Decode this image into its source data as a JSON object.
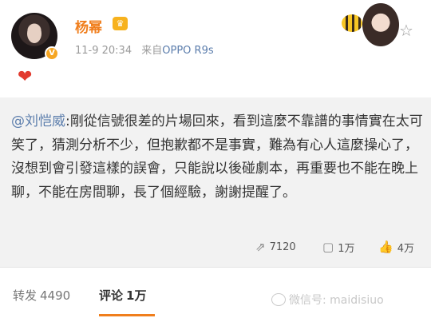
{
  "user": {
    "name": "杨幂",
    "verified_badge": "V",
    "member_badge": "♛",
    "time": "11-9 20:34",
    "source_prefix": "来自",
    "source": "OPPO R9s"
  },
  "post": {
    "emoji": "heart-icon"
  },
  "repost": {
    "mention": "@刘恺威",
    "text": ":剛從信號很差的片場回來，看到這麼不靠譜的事情實在太可笑了，猜測分析不少，但抱歉都不是事實，難為有心人這麼操心了，沒想到會引發這樣的誤會，只能說以後碰劇本，再重要也不能在晚上聊，不能在房間聊，長了個經驗，謝謝提醒了。",
    "stats": {
      "reposts": "7120",
      "comments": "1万",
      "likes": "4万"
    }
  },
  "tabs": {
    "repost_label": "转发",
    "repost_count": "4490",
    "comment_label": "评论",
    "comment_count": "1万"
  },
  "watermark": {
    "text": "微信号: maidisiuo"
  },
  "colors": {
    "accent": "#f07e1c",
    "link": "#5b7dac",
    "repost_bg": "#f2f2f2"
  }
}
